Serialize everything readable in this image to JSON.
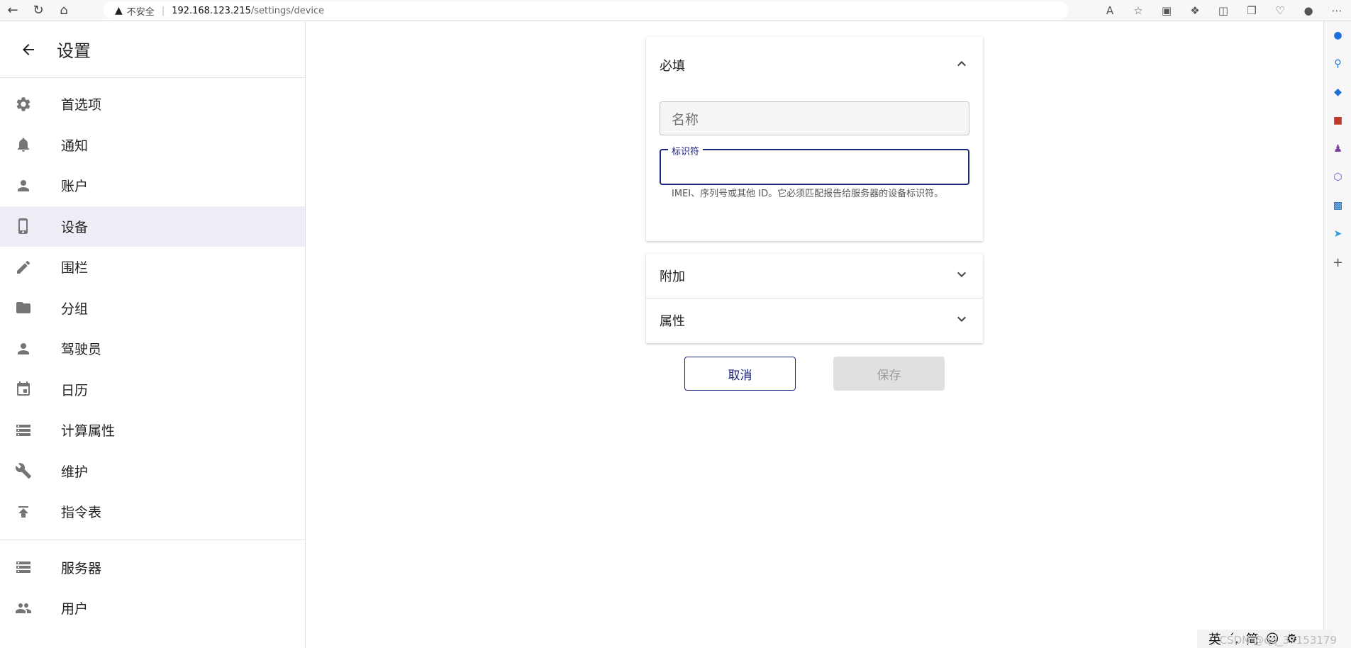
{
  "browser": {
    "insecure_label": "不安全",
    "url_host": "192.168.123.215",
    "url_path": "/settings/device"
  },
  "sidebar": {
    "title": "设置",
    "items": [
      {
        "label": "首选项",
        "icon": "gear-icon"
      },
      {
        "label": "通知",
        "icon": "bell-icon"
      },
      {
        "label": "账户",
        "icon": "person-icon"
      },
      {
        "label": "设备",
        "icon": "phone-icon",
        "active": true
      },
      {
        "label": "围栏",
        "icon": "pencil-icon"
      },
      {
        "label": "分组",
        "icon": "folder-icon"
      },
      {
        "label": "驾驶员",
        "icon": "person-icon"
      },
      {
        "label": "日历",
        "icon": "calendar-icon"
      },
      {
        "label": "计算属性",
        "icon": "storage-icon"
      },
      {
        "label": "维护",
        "icon": "wrench-icon"
      },
      {
        "label": "指令表",
        "icon": "publish-icon"
      }
    ],
    "admin_items": [
      {
        "label": "服务器",
        "icon": "storage-icon"
      },
      {
        "label": "用户",
        "icon": "people-icon"
      }
    ]
  },
  "form": {
    "required_title": "必填",
    "name_placeholder": "名称",
    "identifier_label": "标识符",
    "identifier_value": "",
    "identifier_helper": "IMEI、序列号或其他 ID。它必须匹配报告给服务器的设备标识符。",
    "extra_title": "附加",
    "attributes_title": "属性",
    "cancel_label": "取消",
    "save_label": "保存"
  },
  "taskbar": {
    "watermark": "CSDN @qq_37153179",
    "ime_lang": "英",
    "ime_punct": "ˊ,",
    "ime_mode": "简"
  },
  "colors": {
    "accent": "#1a237e",
    "active_bg": "#ecedf5",
    "icon_gray": "#757575"
  }
}
